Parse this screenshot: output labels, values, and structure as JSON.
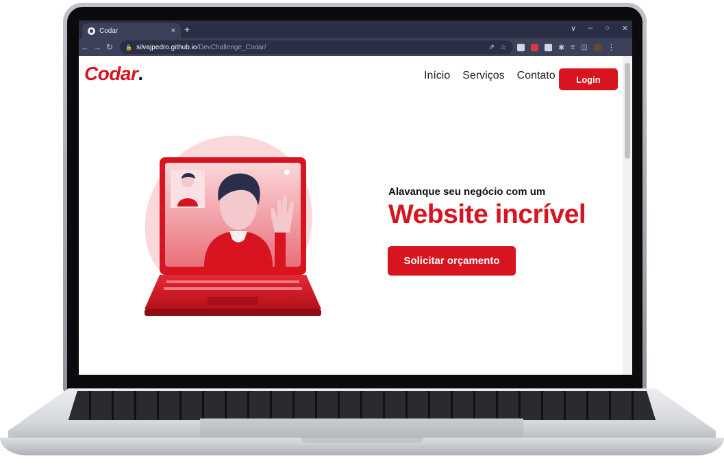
{
  "browser": {
    "tab_title": "Codar",
    "tab_close": "×",
    "new_tab": "+",
    "window_controls": [
      "∨",
      "–",
      "○",
      "✕"
    ],
    "url_host": "silvajpedro.github.io",
    "url_path": "/DevChallenge_Codar/"
  },
  "site": {
    "logo": "Codar",
    "logo_dot": ".",
    "nav": [
      "Início",
      "Serviços",
      "Contato"
    ],
    "login_label": "Login"
  },
  "hero": {
    "subtitle": "Alavanque seu negócio com um",
    "title": "Website incrível",
    "cta_label": "Solicitar orçamento"
  },
  "colors": {
    "brand_red": "#d7141f",
    "browser_dark": "#2b2f45",
    "browser_toolbar": "#3c4159"
  }
}
